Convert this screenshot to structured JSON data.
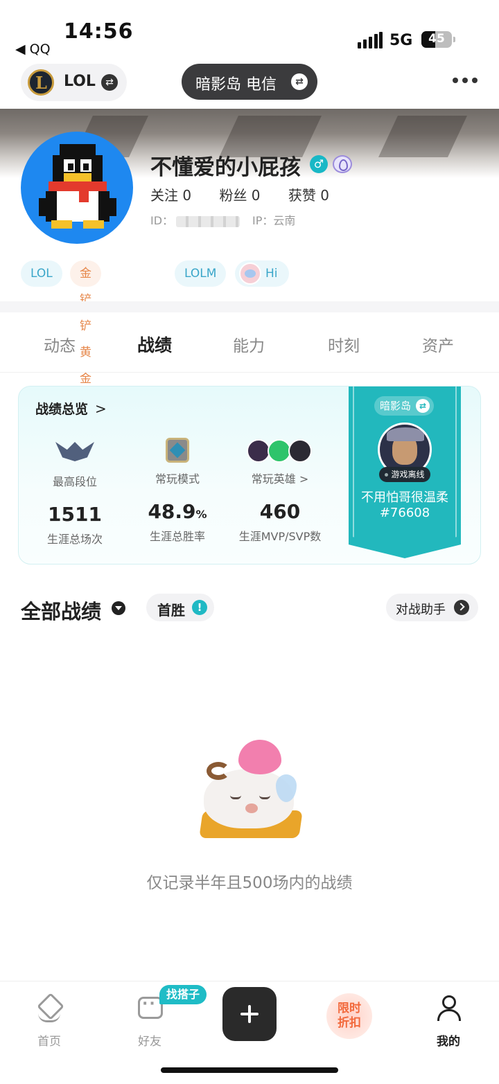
{
  "status_bar": {
    "time": "14:56",
    "back_app": "◀ QQ",
    "network": "5G",
    "battery": "45",
    "battery_level": 0.45
  },
  "top_nav": {
    "game_label": "LOL",
    "server_label": "暗影岛 电信"
  },
  "profile": {
    "nickname": "不懂爱的小屁孩",
    "follow": "关注 0",
    "fans": "粉丝 0",
    "likes": "获赞 0",
    "id_label": "ID：",
    "ip_label": "IP：云南",
    "tags": [
      "LOL",
      "金铲铲 黄金IV",
      "LOLM",
      "Hi"
    ]
  },
  "tabs": [
    "动态",
    "战绩",
    "能力",
    "时刻",
    "资产"
  ],
  "active_tab": "战绩",
  "overview": {
    "title": "战绩总览",
    "col1": {
      "caption": "最高段位",
      "value": "1511",
      "sub": "生涯总场次"
    },
    "col2": {
      "caption": "常玩模式",
      "value": "48.9",
      "unit": "%",
      "sub": "生涯总胜率"
    },
    "col3": {
      "caption": "常玩英雄 >",
      "value": "460",
      "sub": "生涯MVP/SVP数"
    },
    "ribbon": {
      "server": "暗影岛",
      "status": "游戏离线",
      "name": "不用怕哥很温柔",
      "tag": "#76608"
    }
  },
  "records": {
    "title": "全部战绩",
    "first_win": "首胜",
    "assistant": "对战助手",
    "empty_text": "仅记录半年且500场内的战绩"
  },
  "bottom_nav": {
    "home": "首页",
    "friends": "好友",
    "find_badge": "找搭子",
    "promo_line1": "限时",
    "promo_line2": "折扣",
    "me": "我的"
  },
  "colors": {
    "accent": "#20b9c4",
    "ribbon": "#22b8bd",
    "promo": "#f2693c"
  }
}
